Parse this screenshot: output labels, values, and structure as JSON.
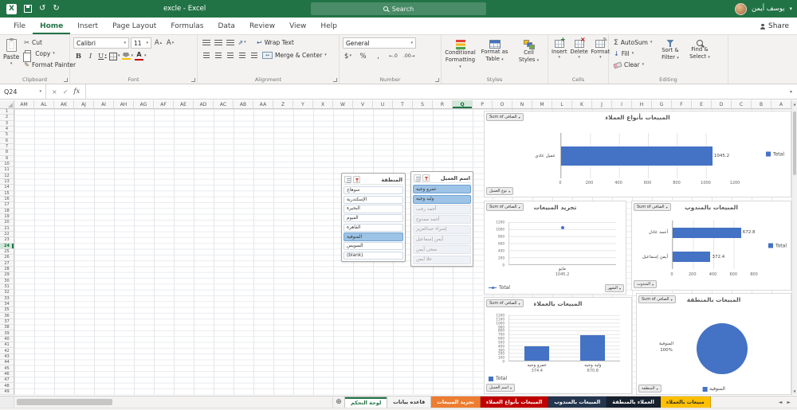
{
  "title_bar": {
    "title": "excle - Excel",
    "search_placeholder": "Search",
    "user_name": "يوسف أيمن"
  },
  "ribbon": {
    "tabs": [
      "File",
      "Home",
      "Insert",
      "Page Layout",
      "Formulas",
      "Data",
      "Review",
      "View",
      "Help"
    ],
    "active_tab": "Home",
    "share_label": "Share",
    "clipboard": {
      "group": "Clipboard",
      "paste": "Paste",
      "cut": "Cut",
      "copy": "Copy",
      "format_painter": "Format Painter"
    },
    "font": {
      "group": "Font",
      "font_name": "Calibri",
      "font_size": "11",
      "bold": "B",
      "italic": "I",
      "underline": "U"
    },
    "alignment": {
      "group": "Alignment",
      "wrap_text": "Wrap Text",
      "merge_center": "Merge & Center"
    },
    "number": {
      "group": "Number",
      "format": "General",
      "currency": "$",
      "percent": "%",
      "comma": ",",
      "inc_decimal": "←.0",
      "dec_decimal": ".00→"
    },
    "styles": {
      "group": "Styles",
      "cf_1": "Conditional",
      "cf_2": "Formatting",
      "ft_1": "Format as",
      "ft_2": "Table",
      "cs_1": "Cell",
      "cs_2": "Styles"
    },
    "cells": {
      "group": "Cells",
      "insert": "Insert",
      "delete": "Delete",
      "format": "Format"
    },
    "editing": {
      "group": "Editing",
      "autosum": "AutoSum",
      "fill": "Fill",
      "clear": "Clear",
      "sort_1": "Sort &",
      "sort_2": "Filter",
      "find_1": "Find &",
      "find_2": "Select"
    }
  },
  "formula_bar": {
    "name_box": "Q24",
    "fx_label": "fx"
  },
  "sheet": {
    "columns": [
      "AM",
      "AL",
      "AK",
      "AJ",
      "AI",
      "AH",
      "AG",
      "AF",
      "AE",
      "AD",
      "AC",
      "AB",
      "AA",
      "Z",
      "Y",
      "X",
      "W",
      "V",
      "U",
      "T",
      "S",
      "R",
      "Q",
      "P",
      "O",
      "N",
      "M",
      "L",
      "K",
      "J",
      "I",
      "H",
      "G",
      "F",
      "E",
      "D",
      "C",
      "B",
      "A"
    ],
    "selected_column": "Q",
    "row_count": 49,
    "selected_row": 24,
    "selected_cell": "Q24"
  },
  "slicers": [
    {
      "title": "المنطقة",
      "items": [
        "سوهاج",
        "الإسكندرية",
        "البحيرة",
        "الفيوم",
        "القاهرة",
        "المنوفية",
        "السويس",
        "(blank)"
      ],
      "selected": [
        "المنوفية"
      ],
      "dimmed": []
    },
    {
      "title": "اسم العميل",
      "items": [
        "عمرو وجيه",
        "وليد وجيه",
        "أحمد رجب",
        "أحمد ممدوح",
        "إسراء عبدالعزيز",
        "أيمن إسماعيل",
        "ضحى أيمن",
        "حلا أيمن"
      ],
      "selected": [
        "عمرو وجيه",
        "وليد وجيه"
      ],
      "dimmed": [
        "أحمد رجب",
        "أحمد ممدوح",
        "إسراء عبدالعزيز",
        "أيمن إسماعيل",
        "ضحى أيمن",
        "حلا أيمن"
      ]
    }
  ],
  "charts": [
    {
      "id": "sales-by-customer-type",
      "title": "المبيعات بأنواع العملاء",
      "type": "bar-h",
      "color": "#4472C4",
      "buttons": {
        "tl": "Sum of الصافي",
        "bl": "نوع العميل"
      },
      "categories": [
        "عميل عادي"
      ],
      "values": [
        1045.2
      ],
      "data_labels": [
        "1045.2"
      ],
      "axis": {
        "min": 0,
        "max": 1200,
        "step": 200
      },
      "legend": "Total",
      "legend_pos": "right"
    },
    {
      "id": "sales-trend",
      "title": "تجريد المبيعات",
      "type": "line",
      "color": "#4472C4",
      "buttons": {
        "tl": "Sum of الصافي",
        "br": "الشهر"
      },
      "categories": [
        "مايو"
      ],
      "values": [
        1045.2
      ],
      "data_labels": [
        "1045.2"
      ],
      "axis": {
        "min": 0,
        "max": 1200,
        "step": 200
      },
      "legend": "Total",
      "legend_pos": "bottom"
    },
    {
      "id": "sales-by-rep",
      "title": "المبيعات بالمندوب",
      "type": "bar-h",
      "color": "#4472C4",
      "buttons": {
        "tl": "Sum of الصافي",
        "bl": "المندوب"
      },
      "categories": [
        "أحمد عادل",
        "أيمن إسماعيل"
      ],
      "values": [
        672.8,
        372.4
      ],
      "data_labels": [
        "672.8",
        "372.4"
      ],
      "axis": {
        "min": 0,
        "max": 800,
        "step": 200
      },
      "legend": "Total",
      "legend_pos": "right"
    },
    {
      "id": "sales-by-customer",
      "title": "المبيعات بالعملاء",
      "type": "column",
      "color": "#4472C4",
      "buttons": {
        "tl": "Sum of الصافي",
        "bl": "اسم العميل"
      },
      "categories": [
        "عمرو وجيه",
        "وليد وجيه"
      ],
      "values": [
        374.4,
        670.8
      ],
      "data_labels": [
        "374.4",
        "670.8"
      ],
      "axis": {
        "min": 0,
        "max": 1200,
        "step": 100
      },
      "legend": "Total",
      "legend_pos": "bottom"
    },
    {
      "id": "sales-by-region",
      "title": "المبيعات بالمنطقة",
      "type": "pie",
      "color": "#4472C4",
      "buttons": {
        "tl": "Sum of الصافي",
        "bl": "المنطقة"
      },
      "categories": [
        "المنوفية"
      ],
      "values": [
        100
      ],
      "data_labels": [
        "المنوفية",
        "100%"
      ],
      "legend": "المنوفية",
      "legend_pos": "bottom-center"
    }
  ],
  "sheet_tabs": [
    {
      "label": "لوحة التحكم",
      "bg": "#ffffff",
      "color": "#217346",
      "active": true
    },
    {
      "label": "قاعده بيانات",
      "bg": "#f4f4f4",
      "color": "#333333",
      "active": false
    },
    {
      "label": "تجريد المبيعات",
      "bg": "#ED7D31",
      "color": "#ffffff",
      "active": false
    },
    {
      "label": "المبيعات بأنواع العملاء",
      "bg": "#C00000",
      "color": "#ffffff",
      "active": false
    },
    {
      "label": "المبيعات بالمندوب",
      "bg": "#24364F",
      "color": "#ffffff",
      "active": false
    },
    {
      "label": "العملاء بالمنطقة",
      "bg": "#17212E",
      "color": "#ffffff",
      "active": false
    },
    {
      "label": "مبيعات بالعملاء",
      "bg": "#FFC000",
      "color": "#333333",
      "active": false
    }
  ]
}
